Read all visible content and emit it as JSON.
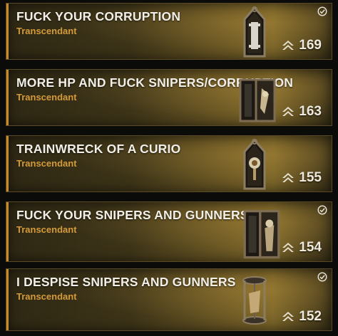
{
  "loadouts": [
    {
      "name": "FUCK YOUR CORRUPTION",
      "rarity": "Transcendant",
      "power": "169",
      "equipped": true,
      "icon": "reliquary-casket-icon"
    },
    {
      "name": "MORE HP AND FUCK SNIPERS/CORRUPTION",
      "rarity": "Transcendant",
      "power": "163",
      "equipped": false,
      "icon": "reliquary-casket-icon"
    },
    {
      "name": "TRAINWRECK OF A CURIO",
      "rarity": "Transcendant",
      "power": "155",
      "equipped": false,
      "icon": "reliquary-casket-icon"
    },
    {
      "name": "FUCK YOUR SNIPERS AND GUNNERS",
      "rarity": "Transcendant",
      "power": "154",
      "equipped": true,
      "icon": "reliquary-casket-icon"
    },
    {
      "name": "I DESPISE SNIPERS AND GUNNERS",
      "rarity": "Transcendant",
      "power": "152",
      "equipped": true,
      "icon": "reliquary-cage-icon"
    }
  ],
  "colors": {
    "rarity": "#d59a3a",
    "accent_bar": "#c98a2a",
    "title": "#f2efe8"
  },
  "icons": {
    "power": "power-level-icon",
    "equipped": "equipped-check-icon"
  }
}
